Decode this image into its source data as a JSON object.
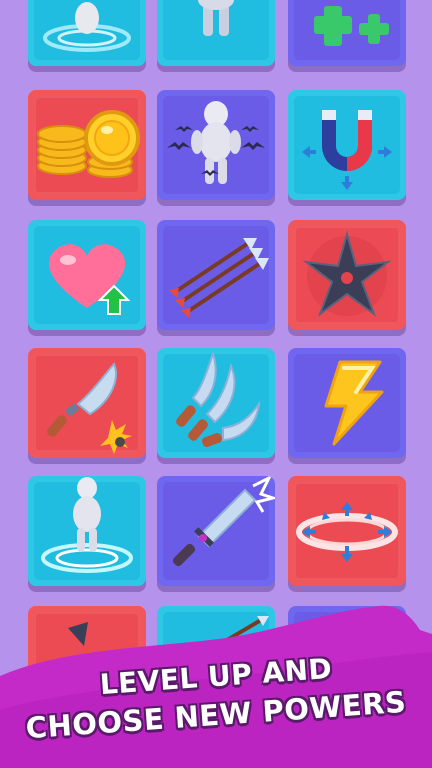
{
  "banner": {
    "line1": "LEVEL UP AND",
    "line2": "CHOOSE NEW POWERS"
  },
  "colors": {
    "background": "#b592ec",
    "tile_red": "#f0565a",
    "tile_cyan": "#2ec8e6",
    "tile_purple": "#7067f0",
    "banner": "#c42ac8"
  },
  "powers": [
    {
      "icon": "hero-portal-icon"
    },
    {
      "icon": "hero-icon"
    },
    {
      "icon": "heal-cross-icon"
    },
    {
      "icon": "gold-coins-icon"
    },
    {
      "icon": "bat-swarm-hero-icon"
    },
    {
      "icon": "magnet-icon"
    },
    {
      "icon": "heart-up-icon"
    },
    {
      "icon": "triple-arrows-icon"
    },
    {
      "icon": "shuriken-icon"
    },
    {
      "icon": "cleaver-crit-icon"
    },
    {
      "icon": "triple-blades-icon"
    },
    {
      "icon": "lightning-icon"
    },
    {
      "icon": "hero-portal-icon"
    },
    {
      "icon": "ice-sword-icon"
    },
    {
      "icon": "shockwave-ring-icon"
    }
  ]
}
